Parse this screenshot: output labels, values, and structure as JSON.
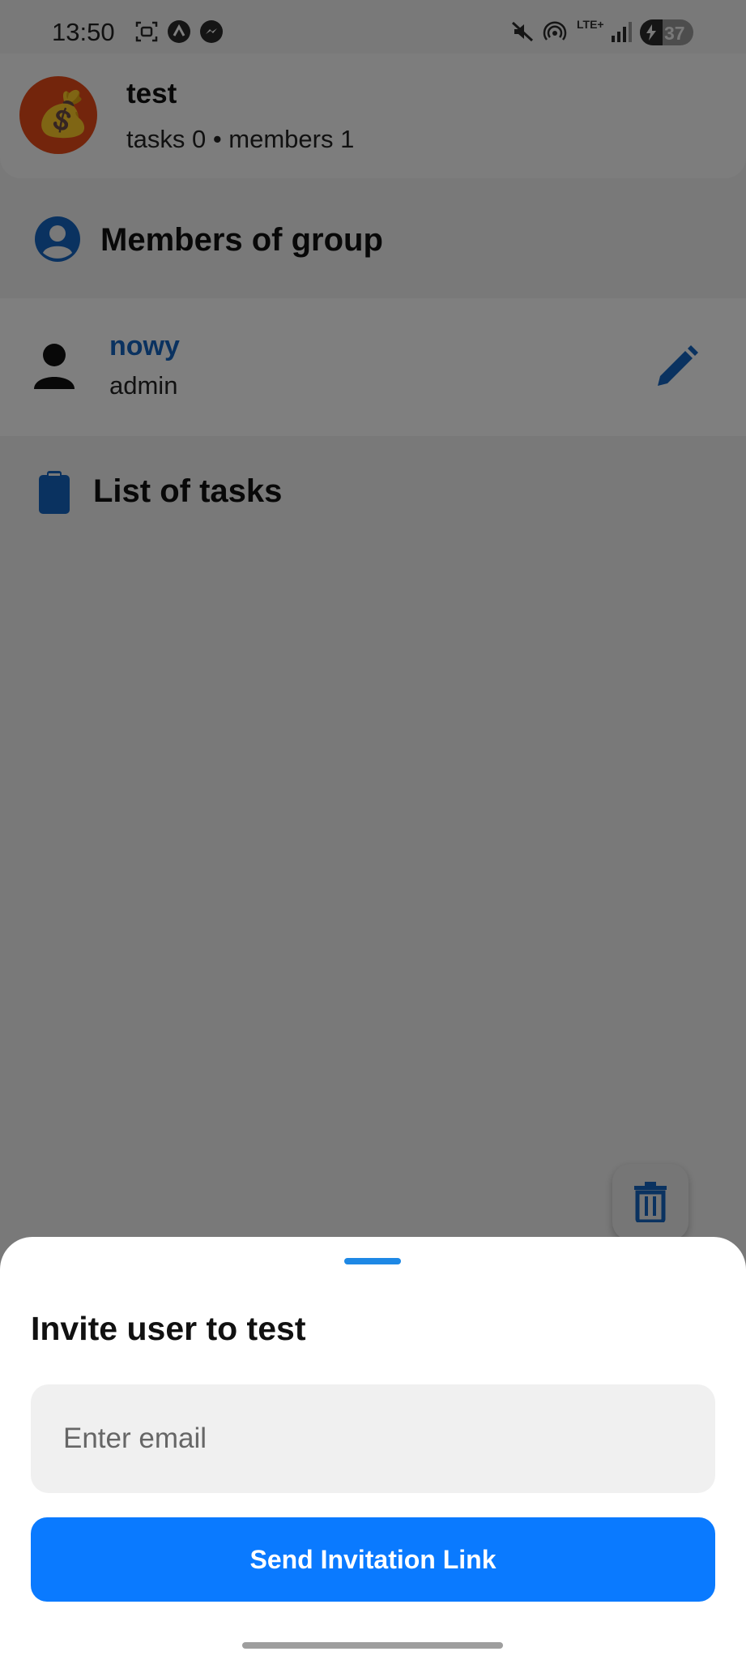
{
  "status_bar": {
    "time": "13:50",
    "network": "LTE+",
    "battery_level": "37",
    "icons": [
      "screenshot-icon",
      "app-notification-icon",
      "messenger-icon",
      "mute-icon",
      "hotspot-icon",
      "signal-icon",
      "battery-charging-icon"
    ]
  },
  "group": {
    "name": "test",
    "stats": "tasks 0 • members 1",
    "avatar_emoji": "💰",
    "avatar_color": "#e64a19"
  },
  "members_section": {
    "title": "Members of group",
    "icon": "account-circle-icon",
    "members": [
      {
        "name": "nowy",
        "role": "admin",
        "icon": "person-icon",
        "action_icon": "edit-pencil-icon"
      }
    ]
  },
  "tasks_section": {
    "title": "List of tasks",
    "icon": "clipboard-icon"
  },
  "fab": {
    "icon": "trash-icon"
  },
  "invite_sheet": {
    "title": "Invite user to test",
    "email_placeholder": "Enter email",
    "email_value": "",
    "button_label": "Send Invitation Link"
  },
  "colors": {
    "accent": "#0a7aff",
    "link": "#1565c0",
    "icon_blue": "#1565c0"
  }
}
